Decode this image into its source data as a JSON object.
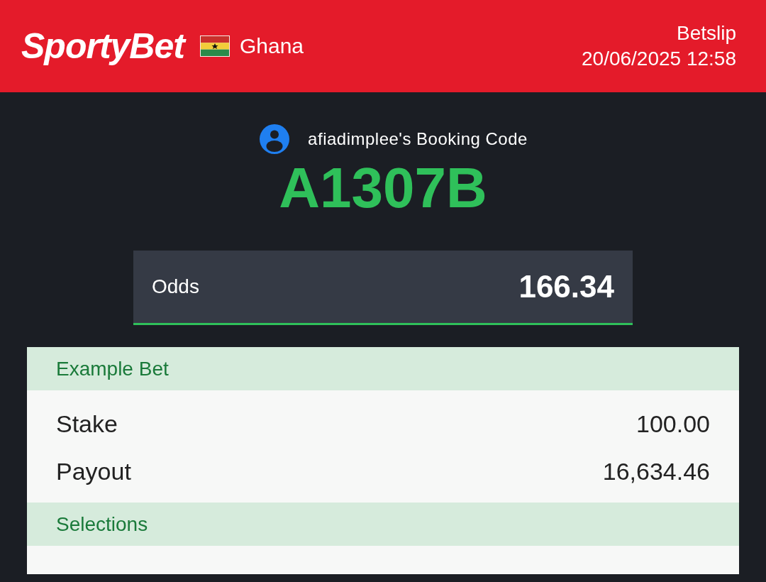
{
  "header": {
    "logo": "SportyBet",
    "country": "Ghana",
    "title": "Betslip",
    "datetime": "20/06/2025 12:58"
  },
  "booking": {
    "label": "afiadimplee's Booking Code",
    "code": "A1307B"
  },
  "odds": {
    "label": "Odds",
    "value": "166.34"
  },
  "bet": {
    "title": "Example Bet",
    "rows": [
      {
        "label": "Stake",
        "value": "100.00"
      },
      {
        "label": "Payout",
        "value": "16,634.46"
      }
    ],
    "section": "Selections"
  }
}
